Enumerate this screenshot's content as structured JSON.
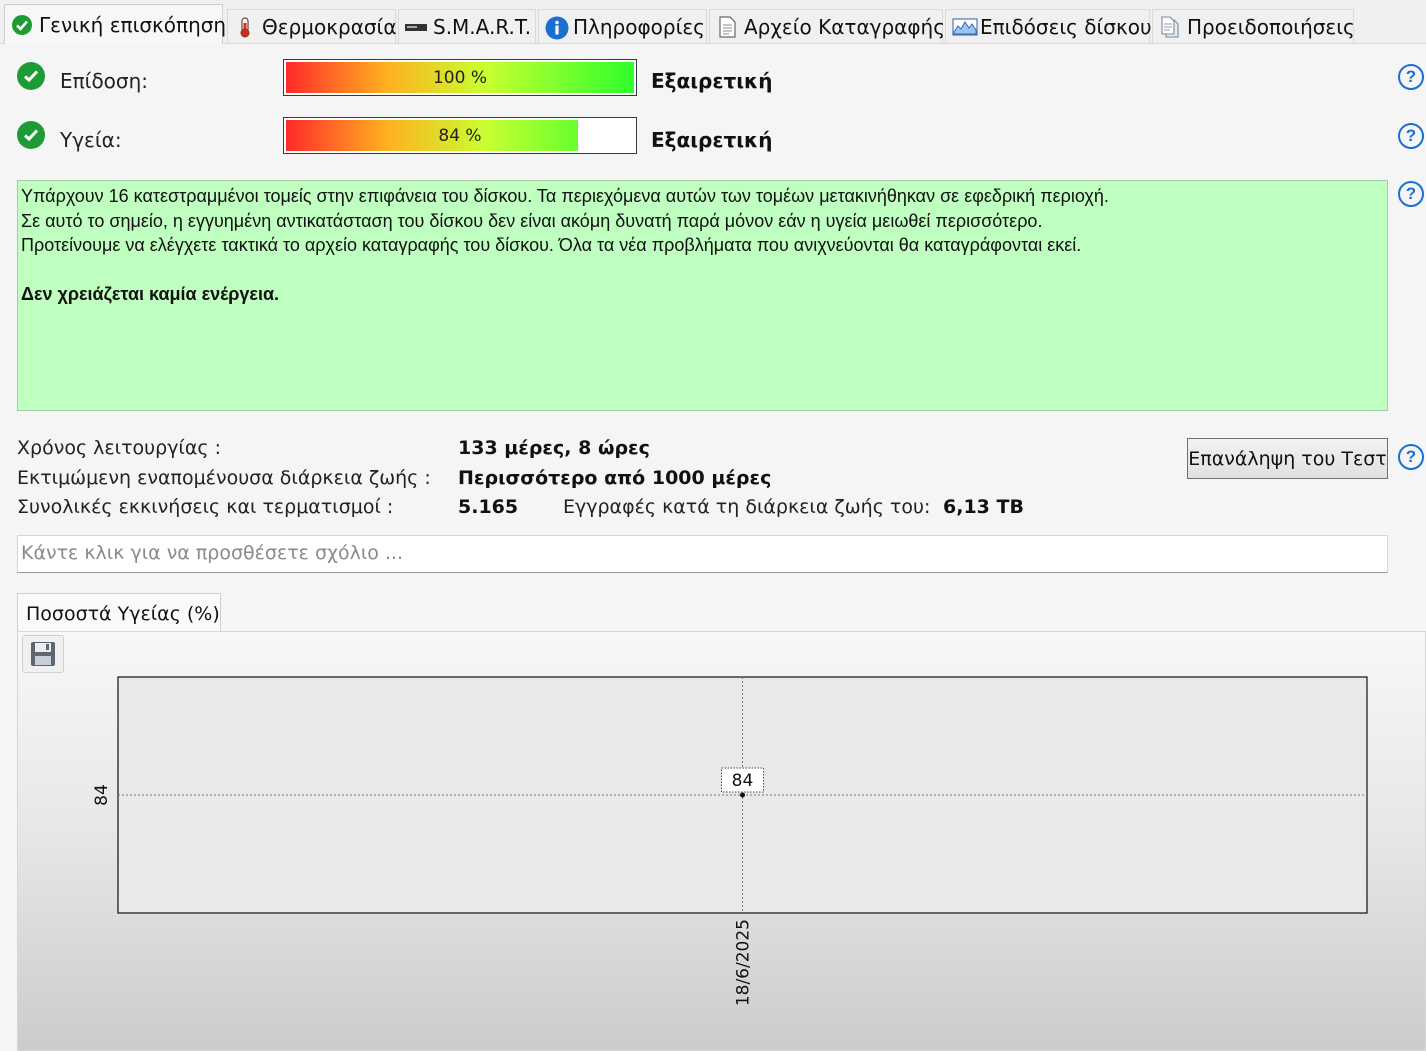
{
  "tabs": [
    {
      "label": "Γενική επισκόπηση",
      "icon": "check-circle-icon",
      "active": true
    },
    {
      "label": "Θερμοκρασία",
      "icon": "thermometer-icon"
    },
    {
      "label": "S.M.A.R.T.",
      "icon": "drive-icon"
    },
    {
      "label": "Πληροφορίες",
      "icon": "info-icon"
    },
    {
      "label": "Αρχείο Καταγραφής",
      "icon": "document-icon"
    },
    {
      "label": "Επιδόσεις δίσκου",
      "icon": "performance-chart-icon"
    },
    {
      "label": "Προειδοποιήσεις",
      "icon": "notifications-icon"
    }
  ],
  "performance": {
    "label": "Επίδοση:",
    "percent_text": "100 %",
    "value": 100,
    "rating": "Εξαιρετική"
  },
  "health": {
    "label": "Υγεία:",
    "percent_text": "84 %",
    "value": 84,
    "rating": "Εξαιρετική"
  },
  "message": {
    "lines": [
      "Υπάρχουν 16 κατεστραμμένοι τομείς στην επιφάνεια του δίσκου. Τα περιεχόμενα αυτών των τομέων μετακινήθηκαν σε εφεδρική περιοχή.",
      "Σε αυτό το σημείο, η εγγυημένη αντικατάσταση του δίσκου δεν είναι ακόμη δυνατή παρά μόνον εάν η υγεία μειωθεί περισσότερο.",
      "Προτείνουμε να ελέγχετε τακτικά το αρχείο καταγραφής του δίσκου. Όλα τα νέα προβλήματα που ανιχνεύονται θα καταγράφονται εκεί."
    ],
    "action": "Δεν χρειάζεται καμία ενέργεια."
  },
  "info": {
    "uptime_label": "Χρόνος λειτουργίας :",
    "uptime_value": "133 μέρες, 8 ώρες",
    "lifetime_label": "Εκτιμώμενη εναπομένουσα διάρκεια ζωής :",
    "lifetime_value": "Περισσότερο από 1000 μέρες",
    "startstop_label": "Συνολικές εκκινήσεις και τερματισμοί :",
    "startstop_value": "5.165",
    "writes_label": "Εγγραφές κατά τη διάρκεια ζωής του:",
    "writes_value": "6,13 TB"
  },
  "retest_button": "Επανάληψη του Τεστ",
  "comment_placeholder": "Κάντε κλικ για να προσθέσετε σχόλιο ...",
  "chart_tab": "Ποσοστά Υγείας (%)",
  "colors": {
    "check": "#1f9b35",
    "help": "#1a6fd0",
    "message_bg": "#bfffbf"
  },
  "chart_data": {
    "type": "line",
    "x": [
      "18/6/2025"
    ],
    "series": [
      {
        "values": [
          84
        ]
      }
    ],
    "data_labels": [
      "84"
    ],
    "y_ticks": [
      "84"
    ],
    "x_ticks": [
      "18/6/2025"
    ],
    "grid": true
  }
}
